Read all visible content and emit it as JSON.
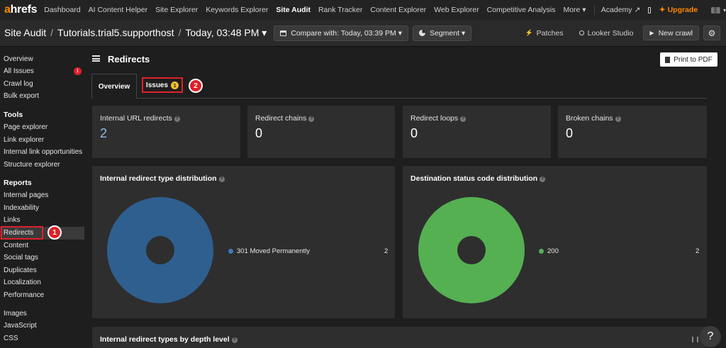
{
  "topnav": {
    "logo_a": "a",
    "logo_rest": "hrefs",
    "items": [
      "Dashboard",
      "AI Content Helper",
      "Site Explorer",
      "Keywords Explorer",
      "Site Audit",
      "Rank Tracker",
      "Content Explorer",
      "Web Explorer",
      "Competitive Analysis",
      "More ▾"
    ],
    "academy": "Academy ↗",
    "upgrade": "Upgrade",
    "upgrade_icon": "✦"
  },
  "projbar": {
    "crumb_root": "Site Audit",
    "crumb_project": "Tutorials.trial5.supporthost",
    "crumb_crawl": "Today, 03:48 PM ▾",
    "compare": "Compare with: Today, 03:39 PM ▾",
    "segment": "Segment ▾",
    "patches": "Patches",
    "looker": "Looker Studio",
    "new_crawl": "New crawl"
  },
  "sidebar": {
    "overview": "Overview",
    "all_issues": "All Issues",
    "all_issues_badge": "1",
    "crawl_log": "Crawl log",
    "bulk_export": "Bulk export",
    "tools_head": "Tools",
    "tools": [
      "Page explorer",
      "Link explorer",
      "Internal link opportunities",
      "Structure explorer"
    ],
    "reports_head": "Reports",
    "reports": [
      "Internal pages",
      "Indexability",
      "Links",
      "Redirects",
      "Content",
      "Social tags",
      "Duplicates",
      "Localization",
      "Performance"
    ],
    "extra": [
      "Images",
      "JavaScript",
      "CSS"
    ]
  },
  "annotations": {
    "marker1": "1",
    "marker2": "2"
  },
  "main": {
    "page_title": "Redirects",
    "print_button": "Print to PDF",
    "tab_overview": "Overview",
    "tab_issues": "Issues",
    "tab_issues_badge": "1",
    "cards": [
      {
        "label": "Internal URL redirects",
        "value": "2"
      },
      {
        "label": "Redirect chains",
        "value": "0"
      },
      {
        "label": "Redirect loops",
        "value": "0"
      },
      {
        "label": "Broken chains",
        "value": "0"
      }
    ],
    "panel1_title": "Internal redirect type distribution",
    "panel1_legend": "301 Moved Permanently",
    "panel1_value": "2",
    "panel1_color": "#2f5f8f",
    "panel2_title": "Destination status code distribution",
    "panel2_legend": "200",
    "panel2_value": "2",
    "panel2_color": "#55b052",
    "bottom_title": "Internal redirect types by depth level",
    "help_label": "?"
  }
}
